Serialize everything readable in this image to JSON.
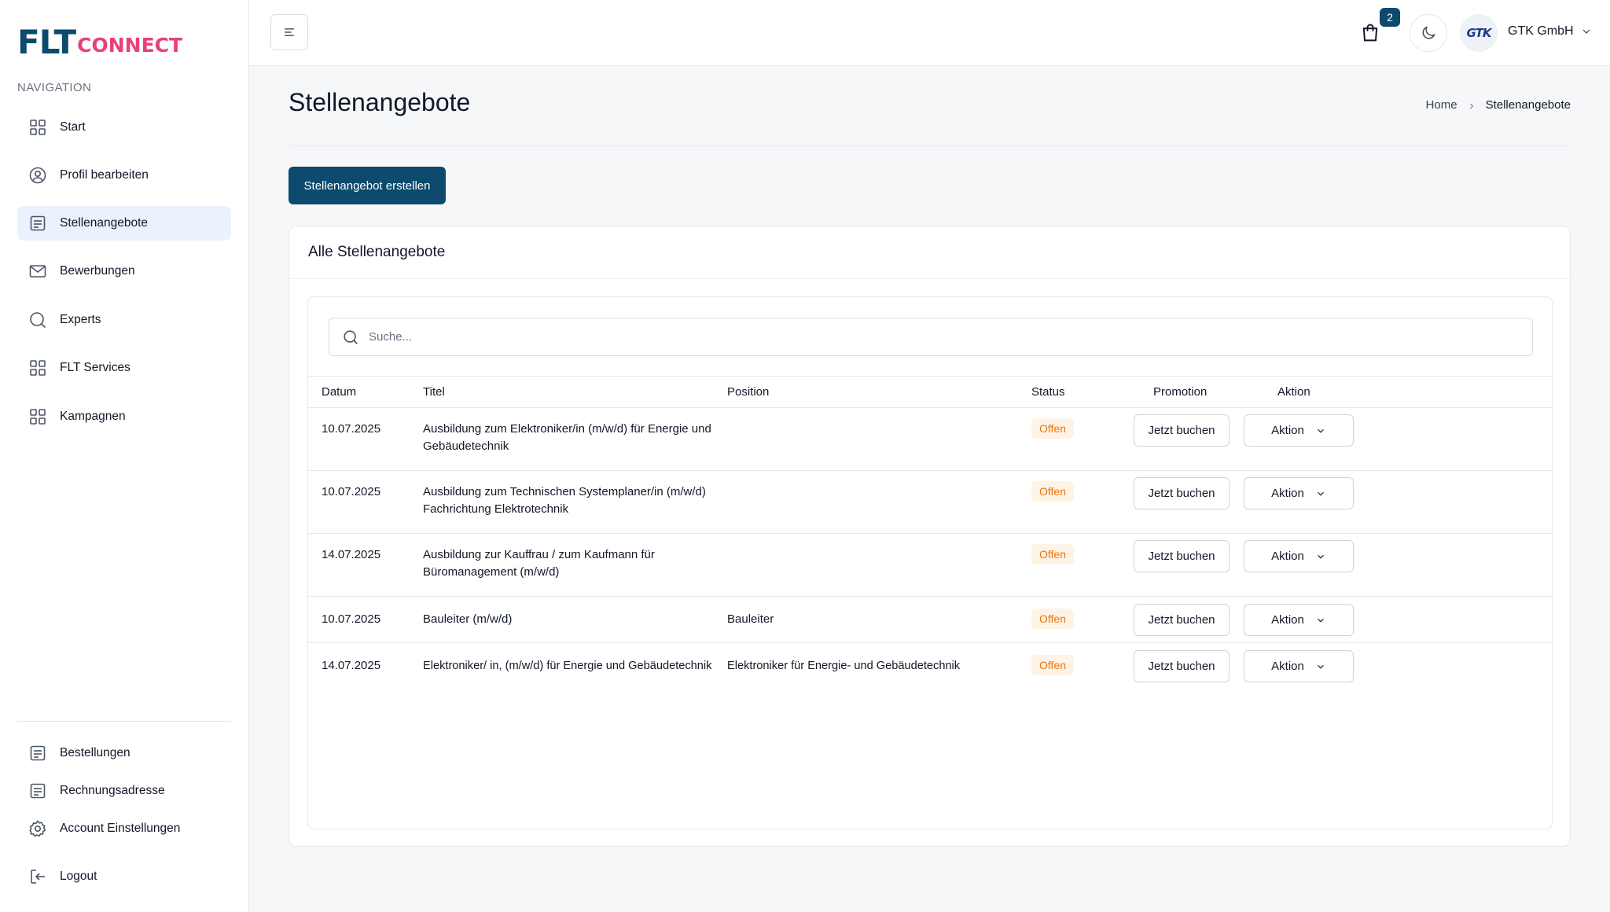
{
  "brand": {
    "part1": "FLT",
    "part2": "CONNECT"
  },
  "sidebar": {
    "heading": "NAVIGATION",
    "items": [
      {
        "label": "Start",
        "icon": "grid-icon"
      },
      {
        "label": "Profil bearbeiten",
        "icon": "user-circle-icon"
      },
      {
        "label": "Stellenangebote",
        "icon": "list-icon",
        "active": true
      },
      {
        "label": "Bewerbungen",
        "icon": "mail-icon"
      },
      {
        "label": "Experts",
        "icon": "search-icon"
      },
      {
        "label": "FLT Services",
        "icon": "grid-icon"
      },
      {
        "label": "Kampagnen",
        "icon": "grid-icon"
      }
    ],
    "bottom_items": [
      {
        "label": "Bestellungen",
        "icon": "list-icon"
      },
      {
        "label": "Rechnungsadresse",
        "icon": "list-icon"
      },
      {
        "label": "Account Einstellungen",
        "icon": "gear-icon"
      },
      {
        "label": "Logout",
        "icon": "logout-icon"
      }
    ]
  },
  "topbar": {
    "cart_count": "2",
    "avatar_text": "GTK",
    "company": "GTK GmbH"
  },
  "page": {
    "title": "Stellenangebote",
    "breadcrumb": {
      "home": "Home",
      "current": "Stellenangebote"
    },
    "create_button": "Stellenangebot erstellen"
  },
  "card": {
    "title": "Alle Stellenangebote",
    "search_placeholder": "Suche...",
    "columns": {
      "date": "Datum",
      "title": "Titel",
      "position": "Position",
      "status": "Status",
      "promotion": "Promotion",
      "action": "Aktion"
    },
    "rows": [
      {
        "date": "10.07.2025",
        "title": "Ausbildung zum Elektroniker/in (m/w/d) für Energie und Gebäudetechnik",
        "position": "",
        "status": "Offen",
        "promo": "Jetzt buchen",
        "action": "Aktion"
      },
      {
        "date": "10.07.2025",
        "title": "Ausbildung zum Technischen Systemplaner/in (m/w/d) Fachrichtung Elektrotechnik",
        "position": "",
        "status": "Offen",
        "promo": "Jetzt buchen",
        "action": "Aktion"
      },
      {
        "date": "14.07.2025",
        "title": "Ausbildung zur Kauffrau / zum Kaufmann für Büromanagement (m/w/d)",
        "position": "",
        "status": "Offen",
        "promo": "Jetzt buchen",
        "action": "Aktion"
      },
      {
        "date": "10.07.2025",
        "title": "Bauleiter (m/w/d)",
        "position": "Bauleiter",
        "status": "Offen",
        "promo": "Jetzt buchen",
        "action": "Aktion"
      },
      {
        "date": "14.07.2025",
        "title": "Elektroniker/ in, (m/w/d) für Energie und Gebäudetechnik",
        "position": "Elektroniker für Energie- und Gebäudetechnik",
        "status": "Offen",
        "promo": "Jetzt buchen",
        "action": "Aktion"
      }
    ]
  },
  "colors": {
    "primary": "#0c4a6e",
    "brand_pink": "#e8407c",
    "status_open": "#e8740c",
    "active_nav_bg": "#eaf2fd"
  }
}
